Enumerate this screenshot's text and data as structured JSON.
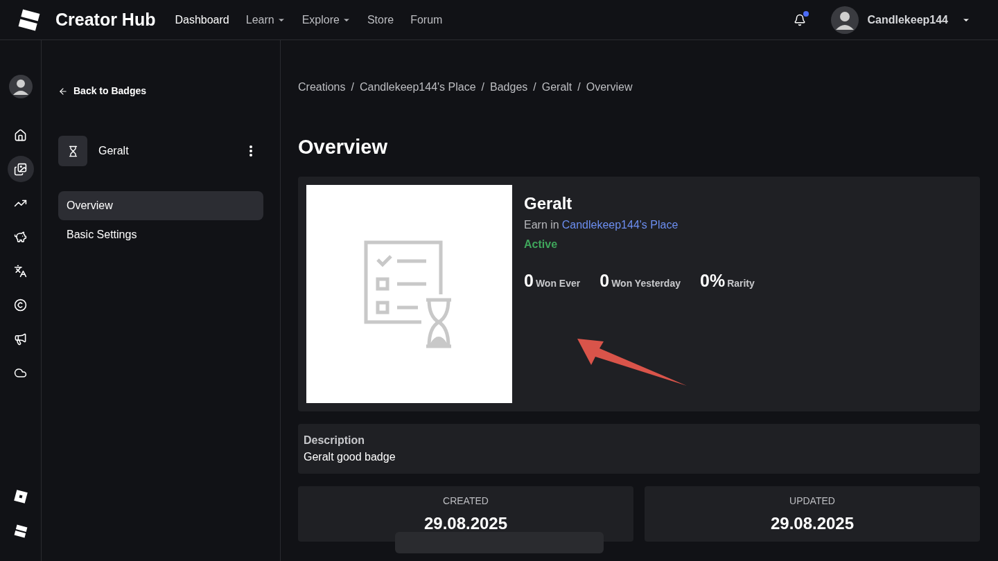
{
  "header": {
    "brand": "Creator Hub",
    "nav": [
      {
        "label": "Dashboard",
        "selected": true,
        "dropdown": false
      },
      {
        "label": "Learn",
        "selected": false,
        "dropdown": true
      },
      {
        "label": "Explore",
        "selected": false,
        "dropdown": true
      },
      {
        "label": "Store",
        "selected": false,
        "dropdown": false
      },
      {
        "label": "Forum",
        "selected": false,
        "dropdown": false
      }
    ],
    "notification_unread": true,
    "username": "Candlekeep144"
  },
  "rail": [
    {
      "kind": "home",
      "selected": false
    },
    {
      "kind": "creations",
      "selected": true
    },
    {
      "kind": "analytics",
      "selected": false
    },
    {
      "kind": "monetization",
      "selected": false
    },
    {
      "kind": "translation",
      "selected": false
    },
    {
      "kind": "copyright",
      "selected": false
    },
    {
      "kind": "ads",
      "selected": false
    },
    {
      "kind": "cloud",
      "selected": false
    }
  ],
  "side_panel": {
    "back": "Back to Badges",
    "badge_name": "Geralt",
    "menu": [
      {
        "label": "Overview",
        "selected": true
      },
      {
        "label": "Basic Settings",
        "selected": false
      }
    ]
  },
  "breadcrumbs": [
    {
      "kind": "link",
      "text": "Creations"
    },
    {
      "kind": "separator",
      "text": "/"
    },
    {
      "kind": "link",
      "text": "Candlekeep144's Place"
    },
    {
      "kind": "separator",
      "text": "/"
    },
    {
      "kind": "link",
      "text": "Badges"
    },
    {
      "kind": "separator",
      "text": "/"
    },
    {
      "kind": "link",
      "text": "Geralt"
    },
    {
      "kind": "separator",
      "text": "/"
    },
    {
      "kind": "link",
      "text": "Overview"
    }
  ],
  "page_title": "Overview",
  "badge": {
    "name": "Geralt",
    "earn_prefix": "Earn in",
    "place": "Candlekeep144's Place",
    "status": {
      "text": "Active",
      "active": true
    },
    "stats": [
      {
        "value": "0",
        "label": "Won Ever"
      },
      {
        "value": "0",
        "label": "Won Yesterday"
      },
      {
        "value": "0%",
        "label": "Rarity"
      }
    ]
  },
  "description": {
    "label": "Description",
    "text": "Geralt good badge"
  },
  "dates": [
    {
      "label": "CREATED",
      "value": "29.08.2025"
    },
    {
      "label": "UPDATED",
      "value": "29.08.2025"
    }
  ]
}
